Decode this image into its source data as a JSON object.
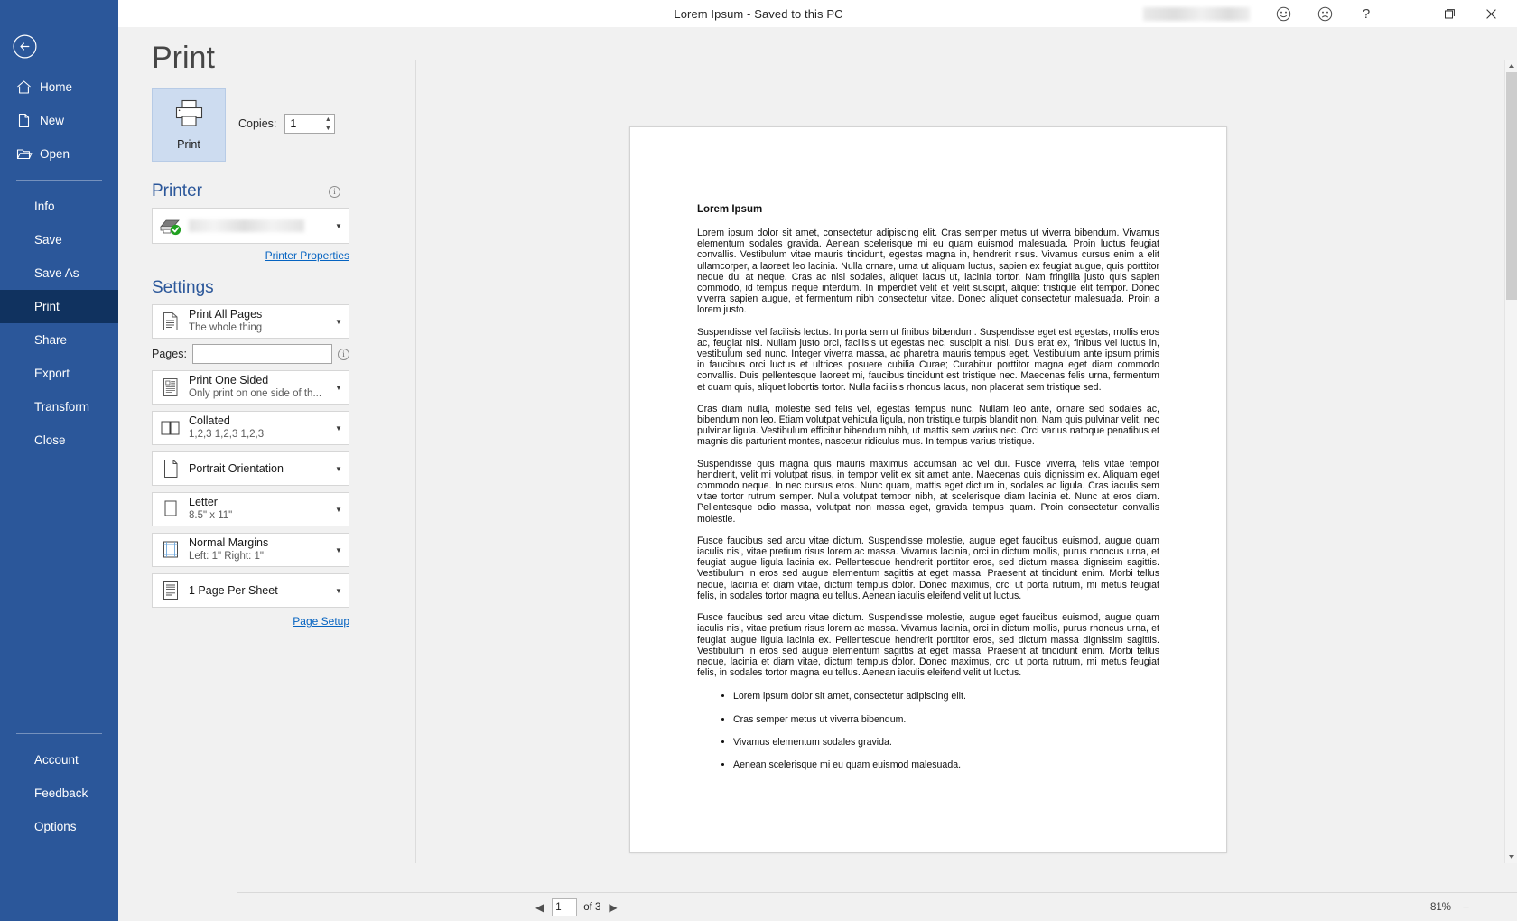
{
  "titlebar": {
    "title": "Lorem Ipsum  -  Saved to this PC",
    "icons": [
      "smiley-happy-icon",
      "smiley-sad-icon",
      "help-icon"
    ],
    "help_glyph": "?",
    "minimize_label": "Minimize",
    "restore_label": "Restore Down",
    "close_label": "Close"
  },
  "sidebar": {
    "back_label": "Back",
    "top_items": [
      {
        "label": "Home",
        "icon": "home-icon"
      },
      {
        "label": "New",
        "icon": "new-document-icon"
      },
      {
        "label": "Open",
        "icon": "open-folder-icon"
      }
    ],
    "items": [
      {
        "label": "Info",
        "selected": false
      },
      {
        "label": "Save",
        "selected": false
      },
      {
        "label": "Save As",
        "selected": false
      },
      {
        "label": "Print",
        "selected": true
      },
      {
        "label": "Share",
        "selected": false
      },
      {
        "label": "Export",
        "selected": false
      },
      {
        "label": "Transform",
        "selected": false
      },
      {
        "label": "Close",
        "selected": false
      }
    ],
    "bottom_items": [
      {
        "label": "Account"
      },
      {
        "label": "Feedback"
      },
      {
        "label": "Options"
      }
    ]
  },
  "page": {
    "title": "Print"
  },
  "print": {
    "button_label": "Print",
    "copies_label": "Copies:",
    "copies_value": "1",
    "spinner_up": "▲",
    "spinner_down": "▼"
  },
  "printer": {
    "heading": "Printer",
    "info_glyph": "i",
    "selected_name": "",
    "status_icon": "printer-ready-icon",
    "properties_link": "Printer Properties"
  },
  "settings": {
    "heading": "Settings",
    "pages_label": "Pages:",
    "pages_value": "",
    "pages_placeholder": "",
    "pages_info_glyph": "i",
    "page_setup_link": "Page Setup",
    "chevron": "▼",
    "options": [
      {
        "name": "print-range",
        "icon": "document-pages-icon",
        "title": "Print All Pages",
        "subtitle": "The whole thing"
      },
      {
        "name": "print-sides",
        "icon": "one-sided-icon",
        "title": "Print One Sided",
        "subtitle": "Only print on one side of th..."
      },
      {
        "name": "collation",
        "icon": "collated-icon",
        "title": "Collated",
        "subtitle": "1,2,3   1,2,3   1,2,3"
      },
      {
        "name": "orientation",
        "icon": "portrait-icon",
        "title": "Portrait Orientation",
        "subtitle": ""
      },
      {
        "name": "paper-size",
        "icon": "paper-icon",
        "title": "Letter",
        "subtitle": "8.5\" x 11\""
      },
      {
        "name": "margins",
        "icon": "margins-icon",
        "title": "Normal Margins",
        "subtitle": "Left:  1\"   Right:  1\""
      },
      {
        "name": "pages-per-sheet",
        "icon": "pages-per-sheet-icon",
        "title": "1 Page Per Sheet",
        "subtitle": ""
      }
    ]
  },
  "document": {
    "heading": "Lorem Ipsum",
    "paragraphs": [
      "Lorem ipsum dolor sit amet, consectetur adipiscing elit. Cras semper metus ut viverra bibendum. Vivamus elementum sodales gravida. Aenean scelerisque mi eu quam euismod malesuada. Proin luctus feugiat convallis. Vestibulum vitae mauris tincidunt, egestas magna in, hendrerit risus. Vivamus cursus enim a elit ullamcorper, a laoreet leo lacinia. Nulla ornare, urna ut aliquam luctus, sapien ex feugiat augue, quis porttitor neque dui at neque. Cras ac nisl sodales, aliquet lacus ut, lacinia tortor. Nam fringilla justo quis sapien commodo, id tempus neque interdum. In imperdiet velit et velit suscipit, aliquet tristique elit tempor. Donec viverra sapien augue, et fermentum nibh consectetur vitae. Donec aliquet consectetur malesuada. Proin a lorem justo.",
      "Suspendisse vel facilisis lectus. In porta sem ut finibus bibendum. Suspendisse eget est egestas, mollis eros ac, feugiat nisi. Nullam justo orci, facilisis ut egestas nec, suscipit a nisi. Duis erat ex, finibus vel luctus in, vestibulum sed nunc. Integer viverra massa, ac pharetra mauris tempus eget. Vestibulum ante ipsum primis in faucibus orci luctus et ultrices posuere cubilia Curae; Curabitur porttitor magna eget diam commodo convallis. Duis pellentesque laoreet mi, faucibus tincidunt est tristique nec. Maecenas felis urna, fermentum et quam quis, aliquet lobortis tortor. Nulla facilisis rhoncus lacus, non placerat sem tristique sed.",
      "Cras diam nulla, molestie sed felis vel, egestas tempus nunc. Nullam leo ante, ornare sed sodales ac, bibendum non leo. Etiam volutpat vehicula ligula, non tristique turpis blandit non. Nam quis pulvinar velit, nec pulvinar ligula. Vestibulum efficitur bibendum nibh, ut mattis sem varius nec. Orci varius natoque penatibus et magnis dis parturient montes, nascetur ridiculus mus. In tempus varius tristique.",
      "Suspendisse quis magna quis mauris maximus accumsan ac vel dui. Fusce viverra, felis vitae tempor hendrerit, velit mi volutpat risus, in tempor velit ex sit amet ante. Maecenas quis dignissim ex. Aliquam eget commodo neque. In nec cursus eros. Nunc quam, mattis eget dictum in, sodales ac ligula. Cras iaculis sem vitae tortor rutrum semper. Nulla volutpat tempor nibh, at scelerisque diam lacinia et. Nunc at eros diam. Pellentesque odio massa, volutpat non massa eget, gravida tempus quam. Proin consectetur convallis molestie.",
      "Fusce faucibus sed arcu vitae dictum. Suspendisse molestie, augue eget faucibus euismod, augue quam iaculis nisl, vitae pretium risus lorem ac massa. Vivamus lacinia, orci in dictum mollis, purus rhoncus urna, et feugiat augue ligula lacinia ex. Pellentesque hendrerit porttitor eros, sed dictum massa dignissim sagittis. Vestibulum in eros sed augue elementum sagittis at eget massa. Praesent at tincidunt enim. Morbi tellus neque, lacinia et diam vitae, dictum tempus dolor. Donec maximus, orci ut porta rutrum, mi metus feugiat felis, in sodales tortor magna eu tellus. Aenean iaculis eleifend velit ut luctus.",
      "Fusce faucibus sed arcu vitae dictum. Suspendisse molestie, augue eget faucibus euismod, augue quam iaculis nisl, vitae pretium risus lorem ac massa. Vivamus lacinia, orci in dictum mollis, purus rhoncus urna, et feugiat augue ligula lacinia ex. Pellentesque hendrerit porttitor eros, sed dictum massa dignissim sagittis. Vestibulum in eros sed augue elementum sagittis at eget massa. Praesent at tincidunt enim. Morbi tellus neque, lacinia et diam vitae, dictum tempus dolor. Donec maximus, orci ut porta rutrum, mi metus feugiat felis, in sodales tortor magna eu tellus. Aenean iaculis eleifend velit ut luctus."
    ],
    "bullets": [
      "Lorem ipsum dolor sit amet, consectetur adipiscing elit.",
      "Cras semper metus ut viverra bibendum.",
      "Vivamus elementum sodales gravida.",
      "Aenean scelerisque mi eu quam euismod malesuada."
    ]
  },
  "statusbar": {
    "prev_glyph": "◀",
    "next_glyph": "▶",
    "page_value": "1",
    "page_of": "of 3",
    "zoom_percent": "81%",
    "zoom_out": "−",
    "zoom_in": "+",
    "fit_glyph": "⊕"
  },
  "colors": {
    "brand_blue": "#2b579a",
    "selected_nav": "#10325f",
    "print_button_fill": "#cddcf0",
    "link": "#0563c1",
    "backstage_bg": "#f1f1f1"
  }
}
